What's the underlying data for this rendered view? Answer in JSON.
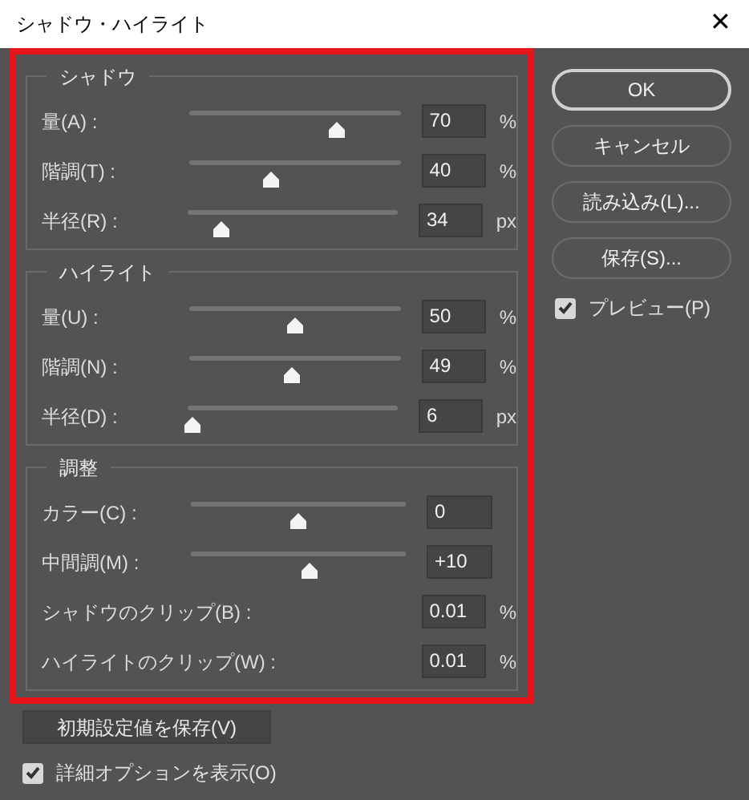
{
  "window": {
    "title": "シャドウ・ハイライト",
    "close": "✕"
  },
  "sections": [
    {
      "title": "シャドウ",
      "rows": [
        {
          "kind": "slider",
          "label": "量(A) :",
          "level": 0.7,
          "value": "70",
          "unit": "%"
        },
        {
          "kind": "slider",
          "label": "階調(T) :",
          "level": 0.39,
          "value": "40",
          "unit": "%"
        },
        {
          "kind": "slider",
          "label": "半径(R) :",
          "level": 0.16,
          "value": "34",
          "unit": "px"
        }
      ]
    },
    {
      "title": "ハイライト",
      "rows": [
        {
          "kind": "slider",
          "label": "量(U) :",
          "level": 0.5,
          "value": "50",
          "unit": "%"
        },
        {
          "kind": "slider",
          "label": "階調(N) :",
          "level": 0.49,
          "value": "49",
          "unit": "%"
        },
        {
          "kind": "slider",
          "label": "半径(D) :",
          "level": 0.02,
          "value": "6",
          "unit": "px"
        }
      ]
    },
    {
      "title": "調整",
      "rows": [
        {
          "kind": "slider",
          "label": "カラー(C) :",
          "level": 0.5,
          "value": "0"
        },
        {
          "kind": "slider",
          "label": "中間調(M) :",
          "level": 0.55,
          "value": "+10"
        },
        {
          "kind": "field",
          "label": "シャドウのクリップ(B) :",
          "value": "0.01",
          "unit": "%"
        },
        {
          "kind": "field",
          "label": "ハイライトのクリップ(W) :",
          "value": "0.01",
          "unit": "%"
        }
      ]
    }
  ],
  "buttons": [
    {
      "label": "OK",
      "default": true
    },
    {
      "label": "キャンセル",
      "default": false
    },
    {
      "label": "読み込み(L)...",
      "default": false
    },
    {
      "label": "保存(S)...",
      "default": false
    }
  ],
  "preview": {
    "label": "プレビュー(P)",
    "checked": true
  },
  "save_defaults": "初期設定値を保存(V)",
  "more_options": {
    "label": "詳細オプションを表示(O)",
    "checked": true
  }
}
